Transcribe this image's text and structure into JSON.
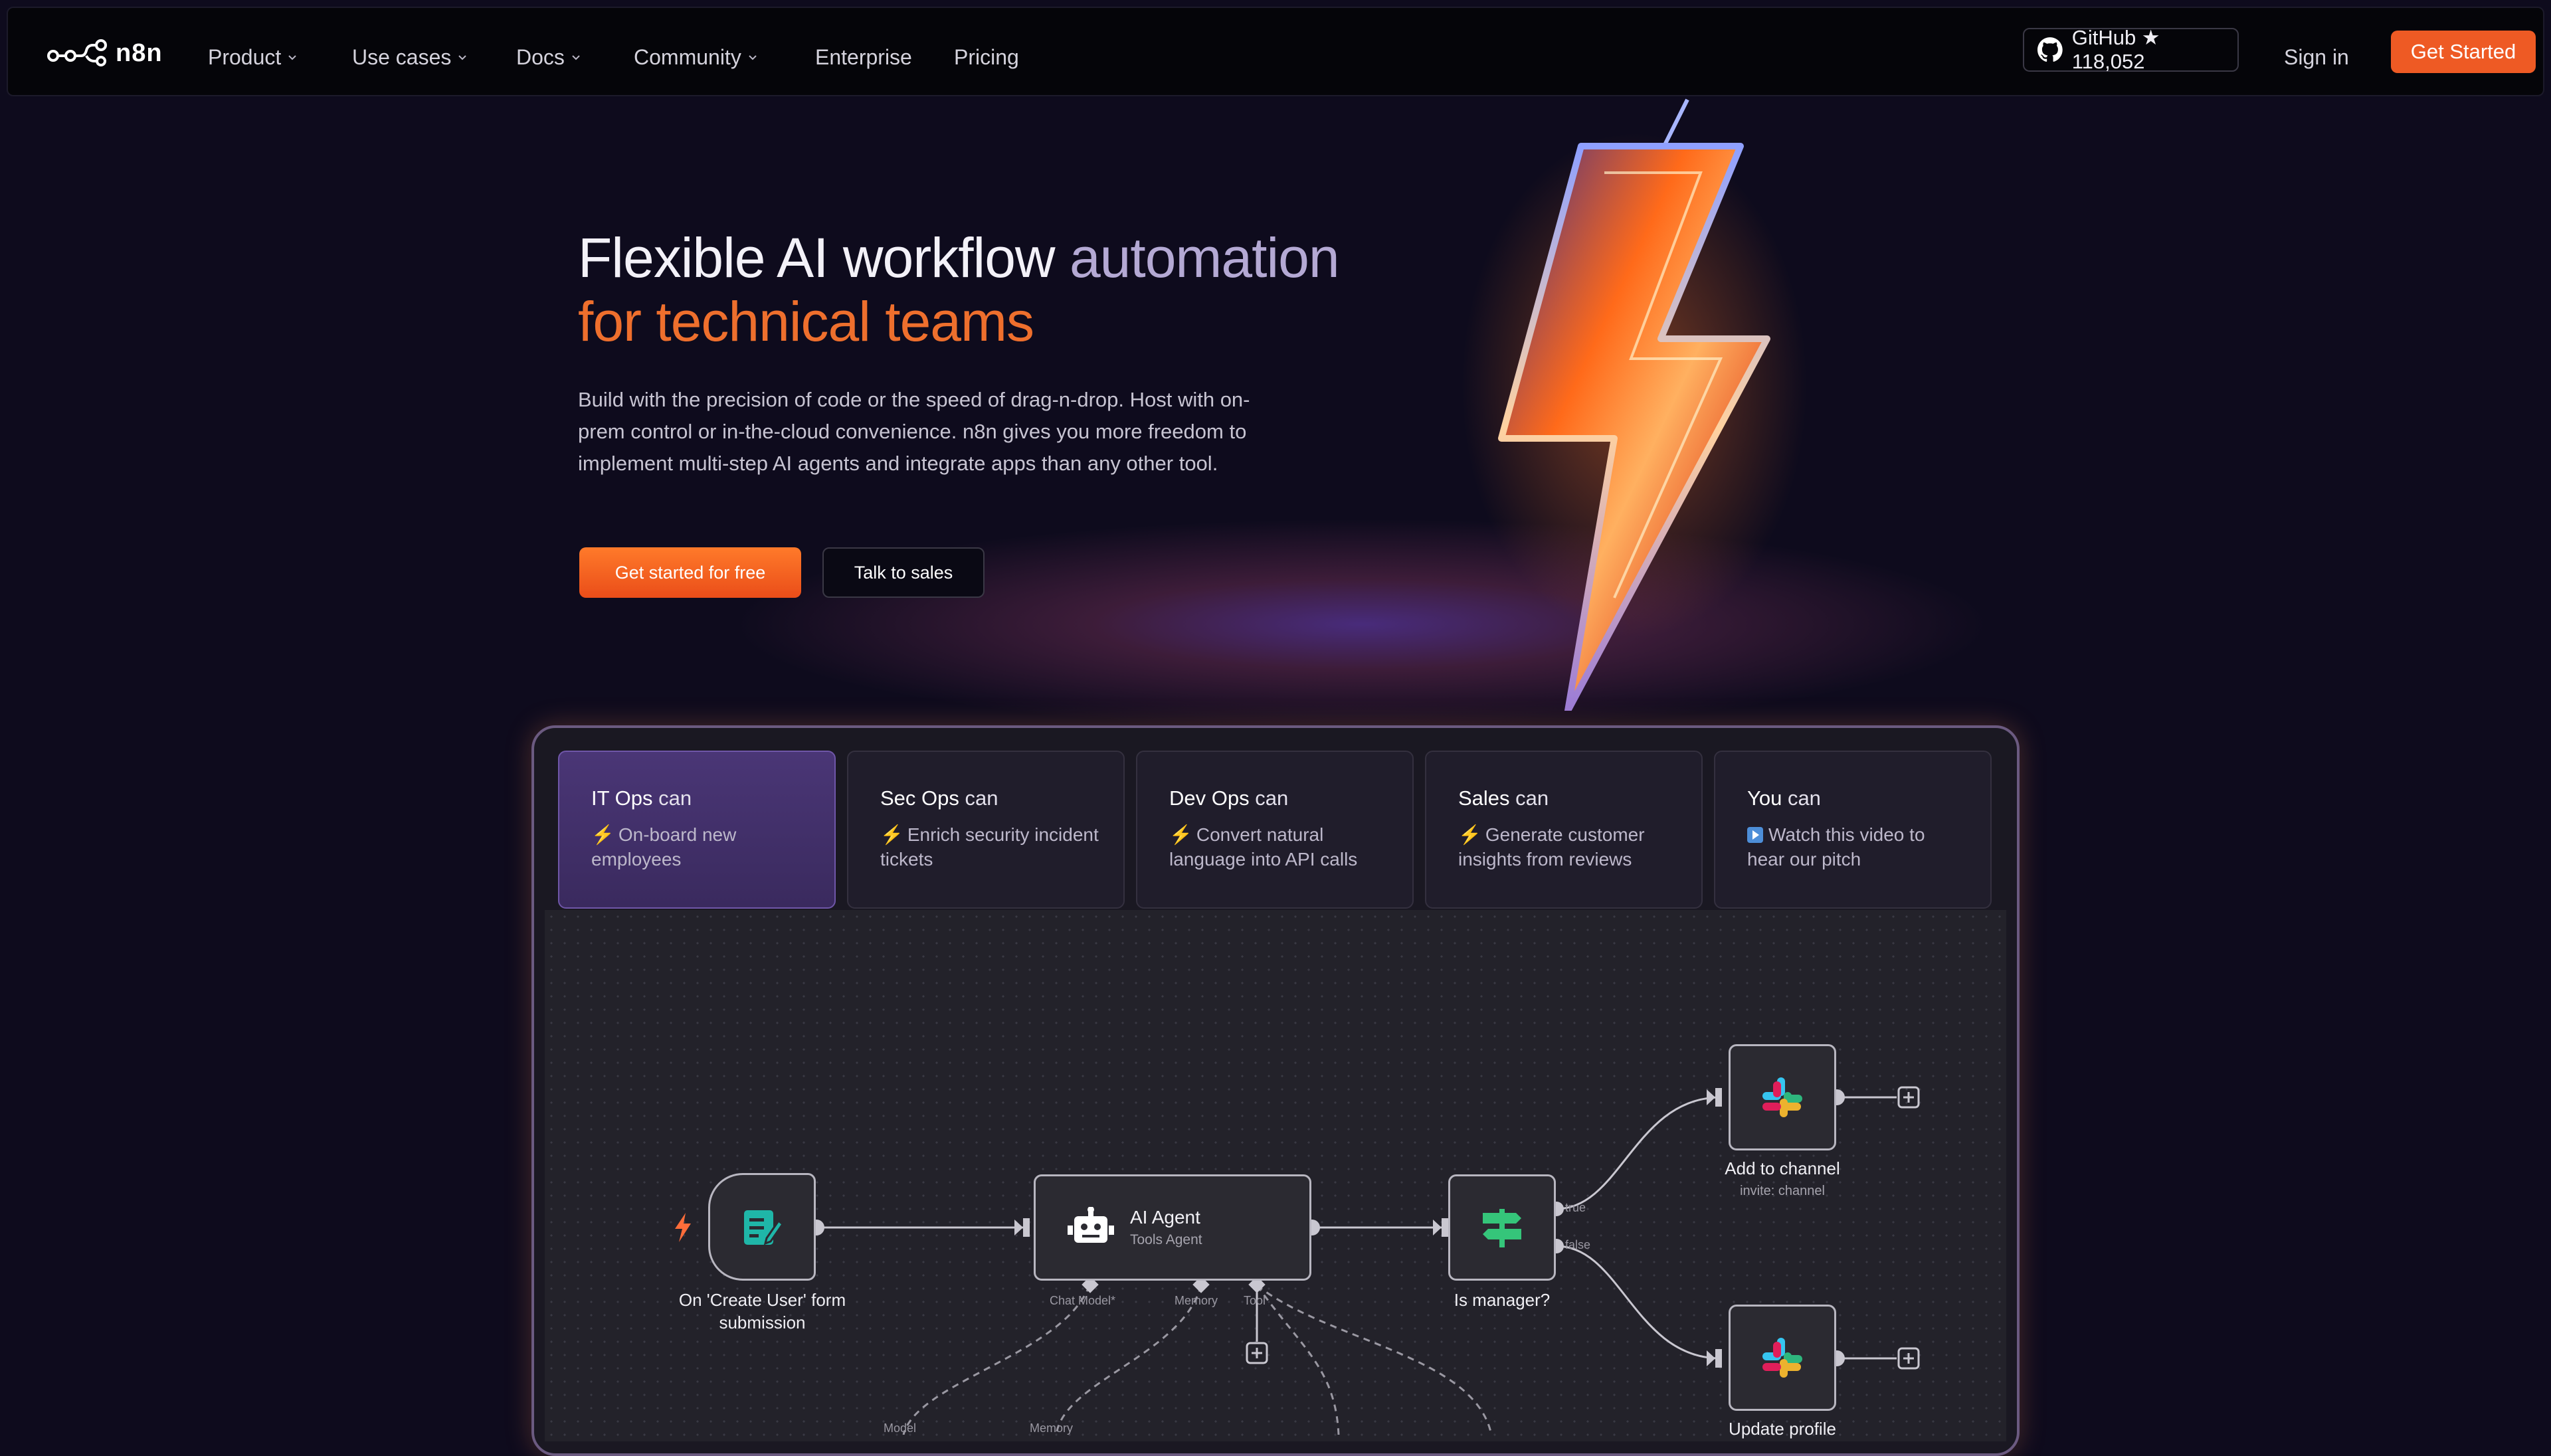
{
  "nav": {
    "logo": "n8n",
    "items": [
      {
        "label": "Product",
        "has_dropdown": true
      },
      {
        "label": "Use cases",
        "has_dropdown": true
      },
      {
        "label": "Docs",
        "has_dropdown": true
      },
      {
        "label": "Community",
        "has_dropdown": true
      },
      {
        "label": "Enterprise",
        "has_dropdown": false
      },
      {
        "label": "Pricing",
        "has_dropdown": false
      }
    ],
    "github_label": "GitHub ★ 118,052",
    "signin": "Sign in",
    "cta": "Get Started"
  },
  "hero": {
    "title_part1": "Flexible AI workflow",
    "title_part2": "automation",
    "title_line2": "for technical teams",
    "description": "Build with the precision of code or the speed of drag-n-drop. Host with on-prem control or in-the-cloud convenience. n8n gives you more freedom to implement multi-step AI agents and integrate apps than any other tool.",
    "primary_button": "Get started for free",
    "secondary_button": "Talk to sales"
  },
  "tabs": [
    {
      "role": "IT Ops",
      "suffix": "can",
      "desc": "On-board new employees",
      "icon": "bolt",
      "active": true
    },
    {
      "role": "Sec Ops",
      "suffix": "can",
      "desc": "Enrich security incident tickets",
      "icon": "bolt",
      "active": false
    },
    {
      "role": "Dev Ops",
      "suffix": "can",
      "desc": "Convert natural language into API calls",
      "icon": "bolt",
      "active": false
    },
    {
      "role": "Sales",
      "suffix": "can",
      "desc": "Generate customer insights from reviews",
      "icon": "bolt",
      "active": false
    },
    {
      "role": "You",
      "suffix": "can",
      "desc": "Watch this video to hear our pitch",
      "icon": "play",
      "active": false
    }
  ],
  "workflow": {
    "trigger": {
      "label": "On 'Create User' form submission",
      "icon": "form-icon"
    },
    "agent": {
      "title": "AI Agent",
      "subtitle": "Tools Agent",
      "icon": "robot-icon",
      "ports": [
        "Chat Model*",
        "Memory",
        "Tool"
      ]
    },
    "condition": {
      "label": "Is manager?",
      "icon": "signpost-icon",
      "branches": [
        "true",
        "false"
      ]
    },
    "slack_top": {
      "label": "Add to channel",
      "sublabel": "invite: channel",
      "icon": "slack-icon"
    },
    "slack_bottom": {
      "label": "Update profile",
      "icon": "slack-icon"
    },
    "bottom_labels": [
      "Model",
      "Memory"
    ]
  },
  "colors": {
    "accent_orange": "#ee5a24",
    "background": "#0e0b1d",
    "active_tab": "#4a3676"
  }
}
